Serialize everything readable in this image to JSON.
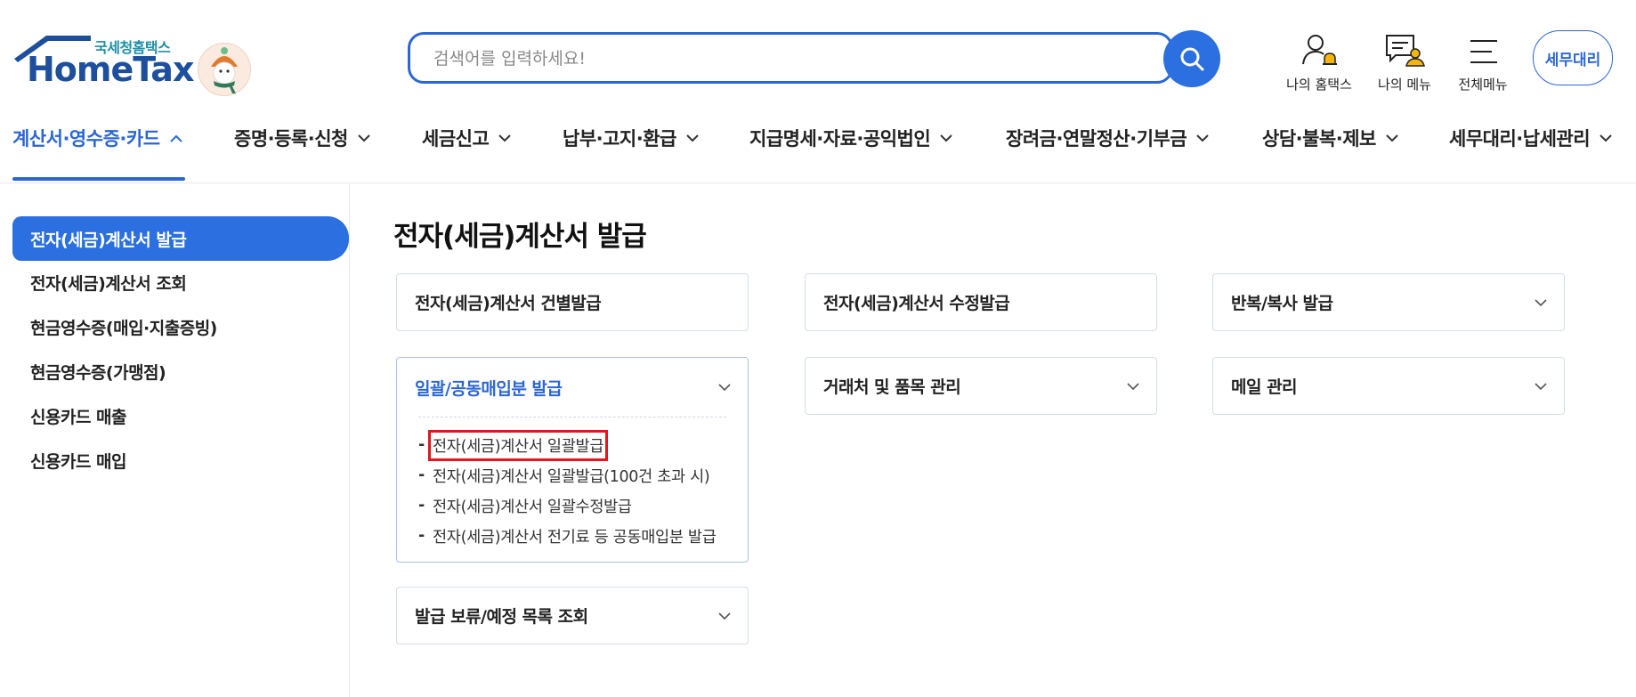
{
  "header": {
    "logo_sub": "국세청홈택스",
    "logo_main": "HomeTax",
    "search_placeholder": "검색어를 입력하세요!",
    "utilities": [
      {
        "label": "나의 홈택스",
        "icon": "user-bell-icon"
      },
      {
        "label": "나의 메뉴",
        "icon": "menu-user-icon"
      },
      {
        "label": "전체메뉴",
        "icon": "hamburger-icon"
      }
    ],
    "agent_button": "세무대리"
  },
  "gnb": [
    {
      "label": "계산서·영수증·카드",
      "active": true
    },
    {
      "label": "증명·등록·신청",
      "active": false
    },
    {
      "label": "세금신고",
      "active": false
    },
    {
      "label": "납부·고지·환급",
      "active": false
    },
    {
      "label": "지급명세·자료·공익법인",
      "active": false
    },
    {
      "label": "장려금·연말정산·기부금",
      "active": false
    },
    {
      "label": "상담·불복·제보",
      "active": false
    },
    {
      "label": "세무대리·납세관리",
      "active": false
    }
  ],
  "sidebar": {
    "items": [
      {
        "label": "전자(세금)계산서 발급",
        "active": true
      },
      {
        "label": "전자(세금)계산서 조회",
        "active": false
      },
      {
        "label": "현금영수증(매입·지출증빙)",
        "active": false
      },
      {
        "label": "현금영수증(가맹점)",
        "active": false
      },
      {
        "label": "신용카드 매출",
        "active": false
      },
      {
        "label": "신용카드 매입",
        "active": false
      }
    ]
  },
  "main": {
    "title": "전자(세금)계산서 발급",
    "cards": [
      {
        "label": "전자(세금)계산서 건별발급"
      },
      {
        "label": "전자(세금)계산서 수정발급"
      },
      {
        "label": "반복/복사 발급"
      },
      {
        "label": "일괄/공동매입분 발급",
        "sub_items": [
          "전자(세금)계산서 일괄발급",
          "전자(세금)계산서 일괄발급(100건 초과 시)",
          "전자(세금)계산서 일괄수정발급",
          "전자(세금)계산서 전기료 등 공동매입분 발급"
        ]
      },
      {
        "label": "거래처 및 품목 관리"
      },
      {
        "label": "메일 관리"
      },
      {
        "label": "발급 보류/예정 목록 조회"
      }
    ]
  },
  "colors": {
    "accent": "#2b6fe0",
    "brand": "#1d4f9c",
    "highlight_box": "#e0171b"
  }
}
